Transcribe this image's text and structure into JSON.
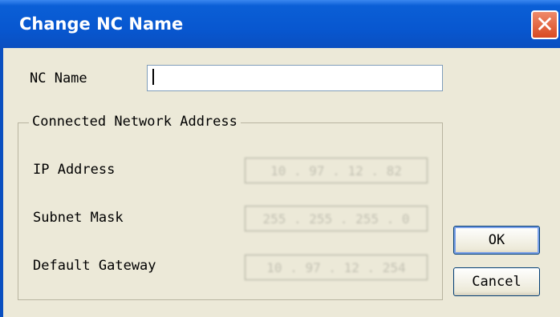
{
  "window": {
    "title": "Change NC Name",
    "close_glyph": "✕"
  },
  "form": {
    "nc_name_label": "NC Name",
    "nc_name_value": ""
  },
  "group": {
    "legend": "Connected Network Address",
    "ip_label": "IP Address",
    "ip_value": "10 . 97 . 12 . 82",
    "subnet_label": "Subnet Mask",
    "subnet_value": "255 . 255 . 255 . 0",
    "gateway_label": "Default Gateway",
    "gateway_value": "10 . 97 . 12 . 254"
  },
  "buttons": {
    "ok_label": "OK",
    "cancel_label": "Cancel"
  }
}
